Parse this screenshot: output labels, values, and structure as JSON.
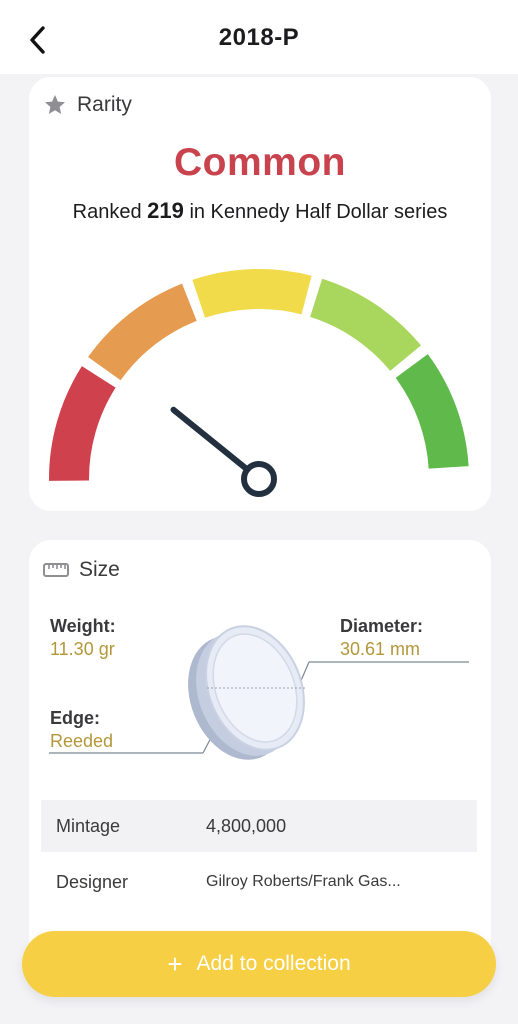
{
  "header": {
    "title": "2018-P"
  },
  "rarity": {
    "section_label": "Rarity",
    "level": "Common",
    "rank_prefix": "Ranked",
    "rank_number": "219",
    "rank_suffix": "in Kennedy Half Dollar series",
    "gauge_colors": [
      "#cf424d",
      "#e69c50",
      "#f1db4a",
      "#a9d65c",
      "#5fb94b"
    ],
    "needle_color": "#22303f",
    "gauge_segment": 1
  },
  "size": {
    "section_label": "Size",
    "weight_label": "Weight:",
    "weight_value": "11.30 gr",
    "diameter_label": "Diameter:",
    "diameter_value": "30.61 mm",
    "edge_label": "Edge:",
    "edge_value": "Reeded"
  },
  "details": [
    {
      "key": "Mintage",
      "value": "4,800,000"
    },
    {
      "key": "Designer",
      "value": "Gilroy Roberts/Frank Gas..."
    }
  ],
  "actions": {
    "add_label": "Add to collection"
  },
  "colors": {
    "accent": "#f6cf45",
    "rarity_text": "#c8434d",
    "spec_value": "#b3973a"
  }
}
